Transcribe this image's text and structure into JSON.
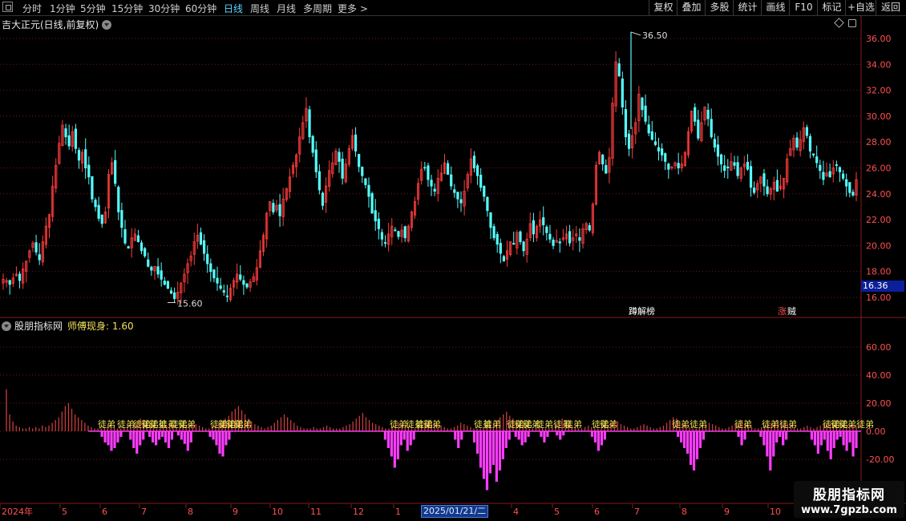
{
  "toolbar": {
    "periods": [
      "分时",
      "1分钟",
      "5分钟",
      "15分钟",
      "30分钟",
      "60分钟",
      "日线",
      "周线",
      "月线",
      "多周期",
      "更多 >"
    ],
    "active_period": "日线",
    "right_buttons": [
      "复权",
      "叠加",
      "多股",
      "统计",
      "画线",
      "F10",
      "标记",
      "+自选",
      "返回"
    ]
  },
  "main_title": "吉大正元(日线,前复权)",
  "indicator": {
    "name": "股朋指标网",
    "label": "师傅现身",
    "value": ": 1.60"
  },
  "chips": {
    "cursor_date": "2025/01/21/二",
    "cursor_price": "16.36"
  },
  "watermark": {
    "line1": "股朋指标网",
    "line2": "www.7gpzb.com"
  },
  "colors": {
    "up": "#ff3c3c",
    "down": "#54ffff",
    "pos_bar": "#c83c3c",
    "neg_bar": "#ff3cff",
    "grid": "#6e1a1a",
    "axis_text": "#ff5050",
    "signal": "#f2e25a"
  },
  "chart_data": [
    {
      "type": "candlestick",
      "title": "吉大正元(日线,前复权)",
      "ylim": [
        15.0,
        37.5
      ],
      "y_ticks": [
        "16.00",
        "18.00",
        "20.00",
        "22.00",
        "24.00",
        "26.00",
        "28.00",
        "30.00",
        "32.00",
        "34.00",
        "36.00"
      ],
      "x_labels": [
        "2024年",
        "5",
        "6",
        "7",
        "8",
        "9",
        "10",
        "11",
        "12",
        "1",
        "2025/01/21/二",
        "4",
        "5",
        "6",
        "7",
        "8",
        "9",
        "10"
      ],
      "annotations": [
        {
          "text": "36.50",
          "kind": "high",
          "value": 36.5
        },
        {
          "text": "15.60",
          "kind": "low",
          "value": 15.6
        },
        {
          "text": "蹲解榜",
          "color": "#ffffff"
        },
        {
          "text": "涨",
          "color": "#ff5050"
        },
        {
          "text": "贼",
          "color": "#ffffff"
        }
      ],
      "closes": [
        17.4,
        17.3,
        17.0,
        17.5,
        17.8,
        17.3,
        18.2,
        18.8,
        19.6,
        20.2,
        19.5,
        18.9,
        20.3,
        21.5,
        22.4,
        24.6,
        26.2,
        27.9,
        29.3,
        28.4,
        27.7,
        28.8,
        27.5,
        26.6,
        27.2,
        26.0,
        25.3,
        23.6,
        23.0,
        22.1,
        21.7,
        22.6,
        25.5,
        26.4,
        24.8,
        22.6,
        21.4,
        20.2,
        19.8,
        20.6,
        20.9,
        20.3,
        19.6,
        19.2,
        18.4,
        18.1,
        18.4,
        17.8,
        17.4,
        17.0,
        16.7,
        16.3,
        15.9,
        16.4,
        17.1,
        17.8,
        18.6,
        19.2,
        20.3,
        20.8,
        20.1,
        19.4,
        18.6,
        18.0,
        17.5,
        17.1,
        16.7,
        16.4,
        16.1,
        16.7,
        17.3,
        17.8,
        17.4,
        17.0,
        16.8,
        17.2,
        17.6,
        18.3,
        19.6,
        20.8,
        22.5,
        23.4,
        22.6,
        23.1,
        22.3,
        23.6,
        24.4,
        25.3,
        26.2,
        27.0,
        28.4,
        29.5,
        30.6,
        28.4,
        27.2,
        25.7,
        24.3,
        23.1,
        24.6,
        25.8,
        26.4,
        27.3,
        26.5,
        25.2,
        26.3,
        27.5,
        28.5,
        27.3,
        26.1,
        25.4,
        24.7,
        23.8,
        22.5,
        21.9,
        21.3,
        20.5,
        20.2,
        20.9,
        21.5,
        21.2,
        20.7,
        21.2,
        20.6,
        21.5,
        22.6,
        23.4,
        24.8,
        25.9,
        26.0,
        25.1,
        24.6,
        24.2,
        25.2,
        25.6,
        26.4,
        25.5,
        24.6,
        24.1,
        23.6,
        23.3,
        24.2,
        25.5,
        26.7,
        26.0,
        25.4,
        24.5,
        23.8,
        22.7,
        21.4,
        20.6,
        20.1,
        19.4,
        18.8,
        19.6,
        20.3,
        20.1,
        21.0,
        20.3,
        19.6,
        20.5,
        21.7,
        20.9,
        21.5,
        22.0,
        21.6,
        21.0,
        20.5,
        20.0,
        20.4,
        20.2,
        20.6,
        20.9,
        20.2,
        20.6,
        20.9,
        20.4,
        21.3,
        21.7,
        21.2,
        23.2,
        26.2,
        27.2,
        26.3,
        25.6,
        26.8,
        31.0,
        34.2,
        33.1,
        30.7,
        28.4,
        27.5,
        28.5,
        29.5,
        31.7,
        30.5,
        29.6,
        28.7,
        28.2,
        27.8,
        27.3,
        27.0,
        26.5,
        25.9,
        26.1,
        26.4,
        26.0,
        26.3,
        27.2,
        28.8,
        30.4,
        29.6,
        28.3,
        29.5,
        30.7,
        29.8,
        28.4,
        27.6,
        26.9,
        26.3,
        25.8,
        26.0,
        26.5,
        26.2,
        25.4,
        26.0,
        26.3,
        25.9,
        24.5,
        24.1,
        24.8,
        25.3,
        24.6,
        24.0,
        24.4,
        24.9,
        24.2,
        24.6,
        25.2,
        26.7,
        27.5,
        28.3,
        27.6,
        28.2,
        29.1,
        28.5,
        27.3,
        27.0,
        26.4,
        25.8,
        25.1,
        25.6,
        25.3,
        26.0,
        26.2,
        25.7,
        25.2,
        24.6,
        24.1,
        23.9,
        25.1
      ],
      "volume_label": "师傅现身: 1.60"
    },
    {
      "type": "bar",
      "name": "师傅现身",
      "ylim": [
        -30,
        75
      ],
      "y_ticks": [
        "-20.00",
        "0.00",
        "20.00",
        "40.00",
        "60.00"
      ],
      "signal_label": "徒弟",
      "signal_positions": [
        122,
        146,
        166,
        176,
        186,
        198,
        212,
        222,
        262,
        272,
        282,
        292,
        486,
        506,
        518,
        528,
        591,
        603,
        632,
        642,
        652,
        668,
        690,
        704,
        738,
        748,
        838,
        860,
        916,
        950,
        972,
        1026,
        1036,
        1046,
        1068
      ],
      "positive_values": [
        30,
        12,
        7,
        4,
        3,
        2,
        2,
        3,
        2,
        3,
        2,
        4,
        3,
        4,
        6,
        8,
        10,
        14,
        18,
        20,
        16,
        12,
        10,
        8,
        6,
        4,
        3,
        2,
        2,
        2,
        3,
        4,
        5,
        3,
        2,
        2,
        3,
        4,
        3,
        5,
        7,
        9,
        8,
        6,
        4,
        3,
        2,
        2,
        3,
        4,
        6,
        4,
        3,
        2,
        3,
        4,
        5,
        6,
        5,
        4,
        3,
        2,
        2,
        3,
        4,
        5,
        7,
        9,
        11,
        14,
        16,
        18,
        15,
        12,
        9,
        7,
        5,
        4,
        3,
        2,
        3,
        4,
        6,
        8,
        10,
        12,
        10,
        8,
        6,
        4,
        3,
        2,
        2,
        2,
        3,
        2,
        2,
        3,
        4,
        3,
        2,
        2,
        2,
        3,
        4,
        5,
        7,
        9,
        11,
        13,
        10,
        8,
        6,
        5,
        4,
        3,
        2,
        2,
        3,
        4,
        6,
        5,
        4,
        3,
        2,
        2,
        3,
        4,
        5,
        6,
        7,
        6,
        5,
        4,
        3,
        2,
        2,
        3,
        4,
        6,
        5,
        4,
        3,
        2,
        2,
        2,
        3,
        4,
        5,
        6,
        8,
        10,
        12,
        14,
        11,
        9,
        7,
        5,
        4,
        3,
        2,
        2,
        3,
        4,
        3,
        2,
        2,
        3,
        5,
        7,
        9,
        8,
        6,
        4,
        3,
        2,
        2,
        3,
        4,
        3,
        2,
        2,
        2,
        3,
        4,
        6,
        8,
        7,
        5,
        4,
        3,
        2,
        2,
        3,
        4,
        5,
        4,
        3,
        2,
        2,
        3,
        4,
        6,
        8,
        10,
        9,
        7,
        5,
        4,
        3,
        2,
        2,
        3,
        4,
        5,
        6,
        5,
        4,
        3,
        2,
        2,
        3,
        4,
        5,
        6,
        8,
        6,
        4,
        3,
        2,
        2,
        3,
        4,
        5,
        6,
        7,
        8,
        7,
        6,
        5,
        4,
        3,
        2,
        2,
        3,
        4,
        3,
        2,
        3,
        4,
        5,
        6,
        5,
        4,
        3,
        2,
        2,
        3,
        4,
        5,
        4
      ],
      "negative_values": [
        0,
        0,
        0,
        0,
        0,
        0,
        0,
        0,
        0,
        0,
        0,
        0,
        0,
        0,
        0,
        0,
        0,
        0,
        0,
        0,
        0,
        0,
        0,
        0,
        0,
        0,
        0,
        0,
        0,
        0,
        -4,
        -8,
        -10,
        -14,
        -12,
        -8,
        -4,
        0,
        0,
        -6,
        -12,
        -16,
        -10,
        -6,
        0,
        -4,
        -8,
        -10,
        -6,
        -4,
        -8,
        -12,
        -6,
        0,
        -3,
        -6,
        -9,
        -14,
        -8,
        0,
        0,
        0,
        0,
        0,
        -4,
        -6,
        -10,
        -16,
        -18,
        -10,
        -6,
        0,
        0,
        0,
        0,
        0,
        0,
        0,
        0,
        0,
        0,
        0,
        0,
        0,
        0,
        0,
        0,
        0,
        0,
        0,
        0,
        0,
        0,
        0,
        0,
        0,
        0,
        0,
        0,
        0,
        0,
        0,
        0,
        0,
        0,
        0,
        0,
        0,
        0,
        0,
        0,
        0,
        0,
        0,
        0,
        0,
        0,
        0,
        0,
        -6,
        -12,
        -18,
        -26,
        -20,
        -10,
        -6,
        -14,
        -10,
        -6,
        0,
        0,
        0,
        0,
        0,
        0,
        0,
        0,
        0,
        0,
        0,
        0,
        -6,
        -12,
        -6,
        0,
        0,
        0,
        -8,
        -16,
        -26,
        -34,
        -42,
        -30,
        -24,
        -36,
        -28,
        -20,
        -12,
        -6,
        0,
        -4,
        -6,
        -10,
        -8,
        -4,
        0,
        0,
        0,
        -4,
        -8,
        -4,
        0,
        0,
        -3,
        -6,
        -3,
        0,
        0,
        0,
        0,
        0,
        0,
        0,
        0,
        -4,
        -8,
        -14,
        -10,
        -6,
        0,
        0,
        0,
        0,
        0,
        0,
        0,
        0,
        0,
        0,
        0,
        0,
        0,
        0,
        0,
        0,
        0,
        0,
        0,
        0,
        0,
        0,
        -4,
        -8,
        -12,
        -16,
        -24,
        -28,
        -20,
        -12,
        -6,
        0,
        0,
        0,
        0,
        0,
        0,
        0,
        0,
        0,
        0,
        -4,
        -10,
        -6,
        0,
        0,
        0,
        0,
        -4,
        -10,
        -18,
        -28,
        -18,
        -8,
        -4,
        -10,
        -6,
        0,
        0,
        0,
        0,
        0,
        0,
        0,
        -6,
        -10,
        -16,
        -10,
        -6,
        -14,
        -20,
        -12,
        -6,
        -4,
        -10,
        -14,
        -8,
        -18,
        -12
      ]
    }
  ]
}
